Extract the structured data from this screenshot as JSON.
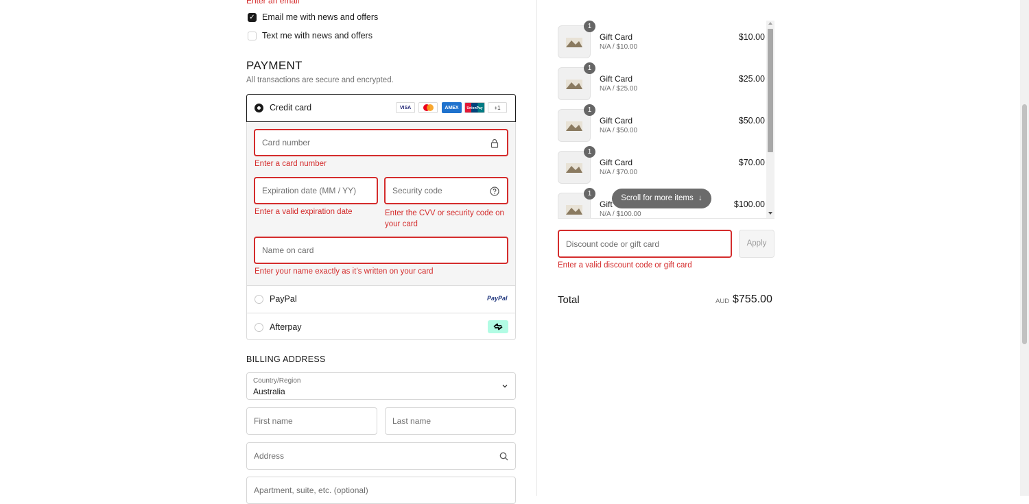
{
  "contact": {
    "email_error": "Enter an email",
    "email_offers_label": "Email me with news and offers",
    "text_offers_label": "Text me with news and offers"
  },
  "payment": {
    "title": "PAYMENT",
    "subtitle": "All transactions are secure and encrypted.",
    "credit_card_label": "Credit card",
    "card_brands": [
      "VISA",
      "MC",
      "AMEX",
      "UnionPay",
      "+1"
    ],
    "card_number_placeholder": "Card number",
    "card_number_error": "Enter a card number",
    "expiry_placeholder": "Expiration date (MM / YY)",
    "expiry_error": "Enter a valid expiration date",
    "cvv_placeholder": "Security code",
    "cvv_error": "Enter the CVV or security code on your card",
    "name_placeholder": "Name on card",
    "name_error": "Enter your name exactly as it’s written on your card",
    "paypal_label": "PayPal",
    "paypal_logo": "PayPal",
    "afterpay_label": "Afterpay"
  },
  "billing": {
    "title": "BILLING ADDRESS",
    "country_label": "Country/Region",
    "country_value": "Australia",
    "first_name_placeholder": "First name",
    "last_name_placeholder": "Last name",
    "address_placeholder": "Address",
    "apartment_placeholder": "Apartment, suite, etc. (optional)"
  },
  "cart": {
    "items": [
      {
        "qty": "1",
        "name": "Gift Card",
        "variant": "N/A / $10.00",
        "price": "$10.00"
      },
      {
        "qty": "1",
        "name": "Gift Card",
        "variant": "N/A / $25.00",
        "price": "$25.00"
      },
      {
        "qty": "1",
        "name": "Gift Card",
        "variant": "N/A / $50.00",
        "price": "$50.00"
      },
      {
        "qty": "1",
        "name": "Gift Card",
        "variant": "N/A / $70.00",
        "price": "$70.00"
      },
      {
        "qty": "1",
        "name": "Gift",
        "variant": "N/A / $100.00",
        "price": "$100.00"
      }
    ],
    "scroll_hint": "Scroll for more items",
    "discount_placeholder": "Discount code or gift card",
    "apply_label": "Apply",
    "discount_error": "Enter a valid discount code or gift card",
    "total_label": "Total",
    "currency": "AUD",
    "total_value": "$755.00"
  },
  "colors": {
    "error": "#d42c2c",
    "text": "#1a1a1a",
    "muted": "#707070"
  }
}
